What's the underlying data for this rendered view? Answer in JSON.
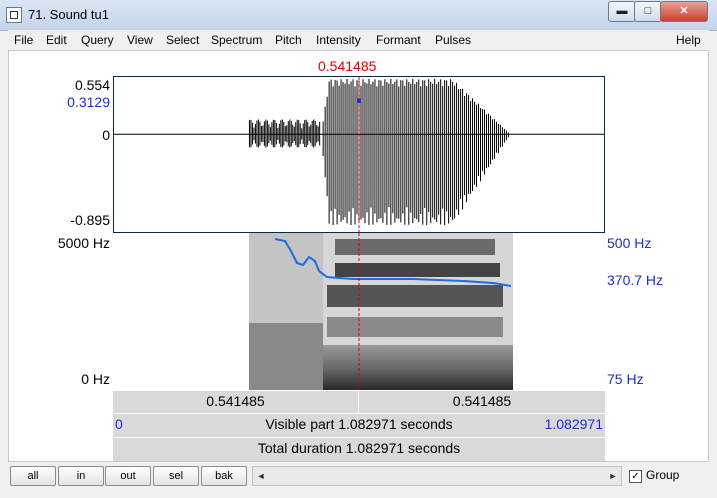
{
  "window": {
    "title": "71. Sound tu1",
    "min_glyph": "▬",
    "max_glyph": "□",
    "close_glyph": "✕"
  },
  "menu": [
    "File",
    "Edit",
    "Query",
    "View",
    "Select",
    "Spectrum",
    "Pitch",
    "Intensity",
    "Formant",
    "Pulses",
    "Help"
  ],
  "cursor_time": "0.541485",
  "waveform": {
    "ymax": "0.554",
    "ycursor": "0.3129",
    "yzero": "0",
    "ymin": "-0.895"
  },
  "spectrogram": {
    "ytop": "5000 Hz",
    "ybottom": "0 Hz",
    "pitch_top": "500 Hz",
    "pitch_cursor": "370.7 Hz",
    "pitch_bottom": "75 Hz"
  },
  "rows": {
    "left_time": "0.541485",
    "right_time": "0.541485",
    "visible_start": "0",
    "visible_label": "Visible part 1.082971 seconds",
    "visible_end": "1.082971",
    "total_label": "Total duration 1.082971 seconds"
  },
  "toolbar": {
    "buttons": [
      "all",
      "in",
      "out",
      "sel",
      "bak"
    ],
    "left_arrow": "◄",
    "right_arrow": "►",
    "group_check": "✓",
    "group_label": "Group"
  },
  "colors": {
    "cursor": "#e00000",
    "pitch": "#1c30c8",
    "pitch_curve": "#1a6fe0"
  }
}
